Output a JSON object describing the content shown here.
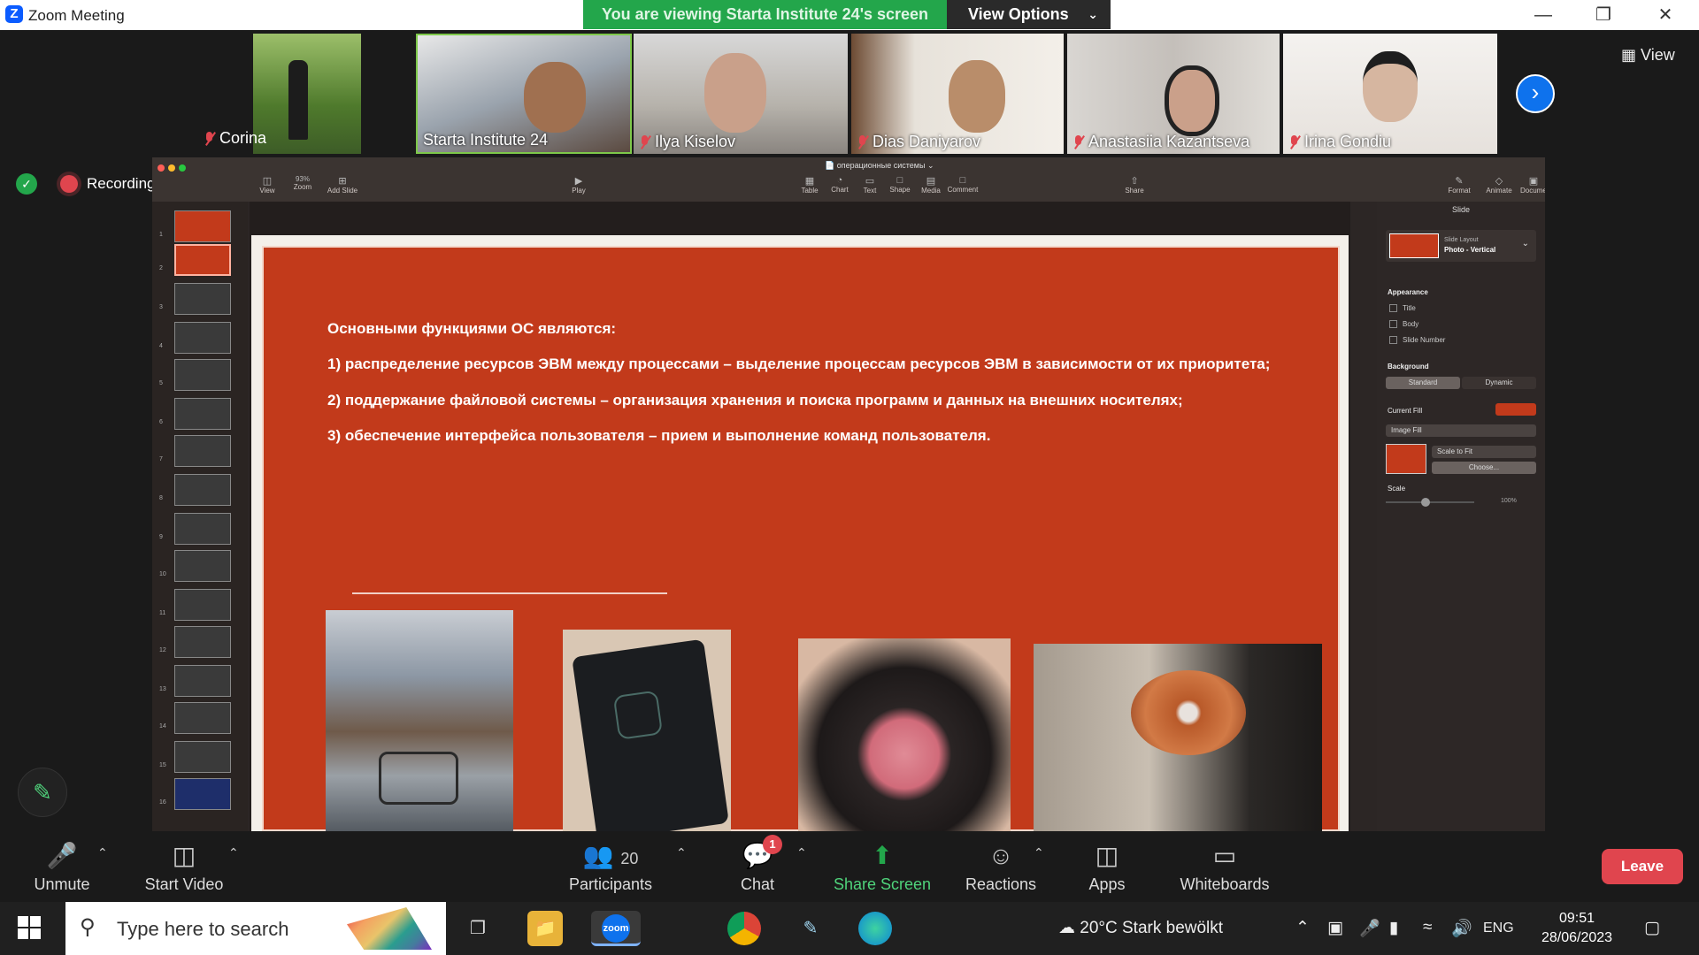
{
  "window": {
    "title": "Zoom Meeting"
  },
  "banner": {
    "text": "You are viewing Starta Institute 24's screen",
    "view_options": "View Options"
  },
  "participants": [
    {
      "name": "Corina",
      "muted": true
    },
    {
      "name": "Starta Institute 24",
      "muted": false,
      "active_speaker": true
    },
    {
      "name": "Ilya Kiselov",
      "muted": true
    },
    {
      "name": "Dias Daniyarov",
      "muted": true
    },
    {
      "name": "Anastasiia Kazantseva",
      "muted": true
    },
    {
      "name": "Irina Gondiu",
      "muted": true
    }
  ],
  "view_button": "View",
  "recording": {
    "label": "Recording"
  },
  "keynote": {
    "doc_title": "операционные системы",
    "toolbar": {
      "view": "View",
      "zoom_value": "93%",
      "zoom": "Zoom",
      "add_slide": "Add Slide",
      "play": "Play",
      "table": "Table",
      "chart": "Chart",
      "text": "Text",
      "shape": "Shape",
      "media": "Media",
      "comment": "Comment",
      "share": "Share",
      "format": "Format",
      "animate": "Animate",
      "document": "Document"
    },
    "slide_numbers": [
      "1",
      "2",
      "3",
      "4",
      "5",
      "6",
      "7",
      "8",
      "9",
      "10",
      "11",
      "12",
      "13",
      "14",
      "15",
      "16"
    ],
    "slide_text": {
      "heading": "Основными функциями ОС являются:",
      "item1": "1) распределение ресурсов ЭВМ между процессами – выделение процессам ресурсов ЭВМ в зависимости от их приоритета;",
      "item2": "2) поддержание файловой системы – организация хранения и поиска программ и данных на внешних носителях;",
      "item3": "3) обеспечение интерфейса пользователя – прием и выполнение команд пользователя."
    },
    "inspector": {
      "tab": "Slide",
      "layout_label": "Slide Layout",
      "layout_value": "Photo - Vertical",
      "appearance": "Appearance",
      "title": "Title",
      "body": "Body",
      "slide_number": "Slide Number",
      "background": "Background",
      "standard": "Standard",
      "dynamic": "Dynamic",
      "current_fill": "Current Fill",
      "image_fill": "Image Fill",
      "scale_to_fit": "Scale to Fit",
      "choose": "Choose...",
      "scale": "Scale",
      "scale_value": "100%"
    }
  },
  "toolbar": {
    "unmute": "Unmute",
    "start_video": "Start Video",
    "participants_count": "20",
    "participants": "Participants",
    "chat": "Chat",
    "chat_badge": "1",
    "share_screen": "Share Screen",
    "reactions": "Reactions",
    "apps": "Apps",
    "whiteboards": "Whiteboards",
    "leave": "Leave"
  },
  "taskbar": {
    "search_placeholder": "Type here to search",
    "zoom_app": "zoom",
    "weather": "20°C  Stark bewölkt",
    "lang": "ENG",
    "time": "09:51",
    "date": "28/06/2023"
  },
  "colors": {
    "accent": "#0e72ed",
    "slide_bg": "#c23a1b",
    "share_green": "#23a64b",
    "leave_red": "#e0454e"
  }
}
